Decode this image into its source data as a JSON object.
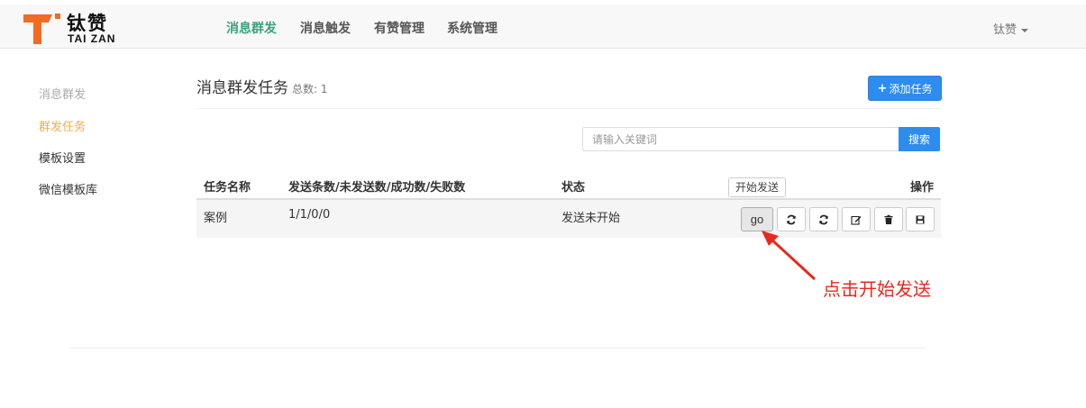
{
  "brand": {
    "name_cn": "钛赞",
    "name_en": "TAI ZAN",
    "colors": {
      "logo_orange": "#f26b21",
      "nav_active": "#3aa17e",
      "primary": "#2d8cf0",
      "sidebar_active": "#f0ad4e",
      "annotation": "#e8291c"
    }
  },
  "nav": {
    "items": [
      {
        "label": "消息群发",
        "active": true
      },
      {
        "label": "消息触发",
        "active": false
      },
      {
        "label": "有赞管理",
        "active": false
      },
      {
        "label": "系统管理",
        "active": false
      }
    ],
    "user": "钛赞"
  },
  "sidebar": {
    "items": [
      {
        "label": "消息群发",
        "state": "muted"
      },
      {
        "label": "群发任务",
        "state": "active"
      },
      {
        "label": "模板设置",
        "state": "normal"
      },
      {
        "label": "微信模板库",
        "state": "normal"
      }
    ]
  },
  "page": {
    "title": "消息群发任务",
    "total_label": "总数: 1",
    "add_button": "添加任务",
    "add_icon": "plus-icon"
  },
  "search": {
    "placeholder": "请输入关键词",
    "button": "搜索"
  },
  "table": {
    "headers": [
      "任务名称",
      "发送条数/未发送数/成功数/失败数",
      "状态",
      "操作"
    ],
    "rows": [
      {
        "name": "案例",
        "counts": "1/1/0/0",
        "status": "发送未开始",
        "actions": {
          "go": "go",
          "icons": [
            "refresh-icon",
            "refresh-icon",
            "edit-icon",
            "trash-icon",
            "save-icon"
          ]
        }
      }
    ]
  },
  "tooltip": "开始发送",
  "annotation": "点击开始发送"
}
